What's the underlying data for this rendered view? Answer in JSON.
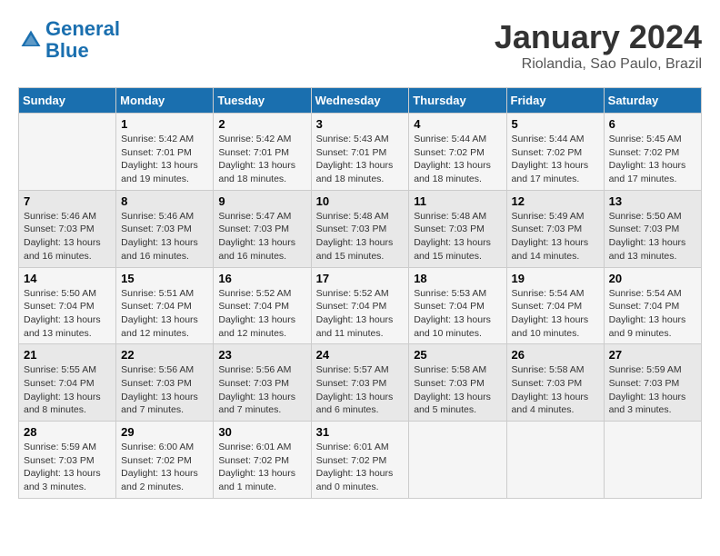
{
  "header": {
    "logo_line1": "General",
    "logo_line2": "Blue",
    "month_title": "January 2024",
    "subtitle": "Riolandia, Sao Paulo, Brazil"
  },
  "days_of_week": [
    "Sunday",
    "Monday",
    "Tuesday",
    "Wednesday",
    "Thursday",
    "Friday",
    "Saturday"
  ],
  "weeks": [
    [
      {
        "day": "",
        "info": ""
      },
      {
        "day": "1",
        "info": "Sunrise: 5:42 AM\nSunset: 7:01 PM\nDaylight: 13 hours\nand 19 minutes."
      },
      {
        "day": "2",
        "info": "Sunrise: 5:42 AM\nSunset: 7:01 PM\nDaylight: 13 hours\nand 18 minutes."
      },
      {
        "day": "3",
        "info": "Sunrise: 5:43 AM\nSunset: 7:01 PM\nDaylight: 13 hours\nand 18 minutes."
      },
      {
        "day": "4",
        "info": "Sunrise: 5:44 AM\nSunset: 7:02 PM\nDaylight: 13 hours\nand 18 minutes."
      },
      {
        "day": "5",
        "info": "Sunrise: 5:44 AM\nSunset: 7:02 PM\nDaylight: 13 hours\nand 17 minutes."
      },
      {
        "day": "6",
        "info": "Sunrise: 5:45 AM\nSunset: 7:02 PM\nDaylight: 13 hours\nand 17 minutes."
      }
    ],
    [
      {
        "day": "7",
        "info": "Sunrise: 5:46 AM\nSunset: 7:03 PM\nDaylight: 13 hours\nand 16 minutes."
      },
      {
        "day": "8",
        "info": "Sunrise: 5:46 AM\nSunset: 7:03 PM\nDaylight: 13 hours\nand 16 minutes."
      },
      {
        "day": "9",
        "info": "Sunrise: 5:47 AM\nSunset: 7:03 PM\nDaylight: 13 hours\nand 16 minutes."
      },
      {
        "day": "10",
        "info": "Sunrise: 5:48 AM\nSunset: 7:03 PM\nDaylight: 13 hours\nand 15 minutes."
      },
      {
        "day": "11",
        "info": "Sunrise: 5:48 AM\nSunset: 7:03 PM\nDaylight: 13 hours\nand 15 minutes."
      },
      {
        "day": "12",
        "info": "Sunrise: 5:49 AM\nSunset: 7:03 PM\nDaylight: 13 hours\nand 14 minutes."
      },
      {
        "day": "13",
        "info": "Sunrise: 5:50 AM\nSunset: 7:03 PM\nDaylight: 13 hours\nand 13 minutes."
      }
    ],
    [
      {
        "day": "14",
        "info": "Sunrise: 5:50 AM\nSunset: 7:04 PM\nDaylight: 13 hours\nand 13 minutes."
      },
      {
        "day": "15",
        "info": "Sunrise: 5:51 AM\nSunset: 7:04 PM\nDaylight: 13 hours\nand 12 minutes."
      },
      {
        "day": "16",
        "info": "Sunrise: 5:52 AM\nSunset: 7:04 PM\nDaylight: 13 hours\nand 12 minutes."
      },
      {
        "day": "17",
        "info": "Sunrise: 5:52 AM\nSunset: 7:04 PM\nDaylight: 13 hours\nand 11 minutes."
      },
      {
        "day": "18",
        "info": "Sunrise: 5:53 AM\nSunset: 7:04 PM\nDaylight: 13 hours\nand 10 minutes."
      },
      {
        "day": "19",
        "info": "Sunrise: 5:54 AM\nSunset: 7:04 PM\nDaylight: 13 hours\nand 10 minutes."
      },
      {
        "day": "20",
        "info": "Sunrise: 5:54 AM\nSunset: 7:04 PM\nDaylight: 13 hours\nand 9 minutes."
      }
    ],
    [
      {
        "day": "21",
        "info": "Sunrise: 5:55 AM\nSunset: 7:04 PM\nDaylight: 13 hours\nand 8 minutes."
      },
      {
        "day": "22",
        "info": "Sunrise: 5:56 AM\nSunset: 7:03 PM\nDaylight: 13 hours\nand 7 minutes."
      },
      {
        "day": "23",
        "info": "Sunrise: 5:56 AM\nSunset: 7:03 PM\nDaylight: 13 hours\nand 7 minutes."
      },
      {
        "day": "24",
        "info": "Sunrise: 5:57 AM\nSunset: 7:03 PM\nDaylight: 13 hours\nand 6 minutes."
      },
      {
        "day": "25",
        "info": "Sunrise: 5:58 AM\nSunset: 7:03 PM\nDaylight: 13 hours\nand 5 minutes."
      },
      {
        "day": "26",
        "info": "Sunrise: 5:58 AM\nSunset: 7:03 PM\nDaylight: 13 hours\nand 4 minutes."
      },
      {
        "day": "27",
        "info": "Sunrise: 5:59 AM\nSunset: 7:03 PM\nDaylight: 13 hours\nand 3 minutes."
      }
    ],
    [
      {
        "day": "28",
        "info": "Sunrise: 5:59 AM\nSunset: 7:03 PM\nDaylight: 13 hours\nand 3 minutes."
      },
      {
        "day": "29",
        "info": "Sunrise: 6:00 AM\nSunset: 7:02 PM\nDaylight: 13 hours\nand 2 minutes."
      },
      {
        "day": "30",
        "info": "Sunrise: 6:01 AM\nSunset: 7:02 PM\nDaylight: 13 hours\nand 1 minute."
      },
      {
        "day": "31",
        "info": "Sunrise: 6:01 AM\nSunset: 7:02 PM\nDaylight: 13 hours\nand 0 minutes."
      },
      {
        "day": "",
        "info": ""
      },
      {
        "day": "",
        "info": ""
      },
      {
        "day": "",
        "info": ""
      }
    ]
  ]
}
